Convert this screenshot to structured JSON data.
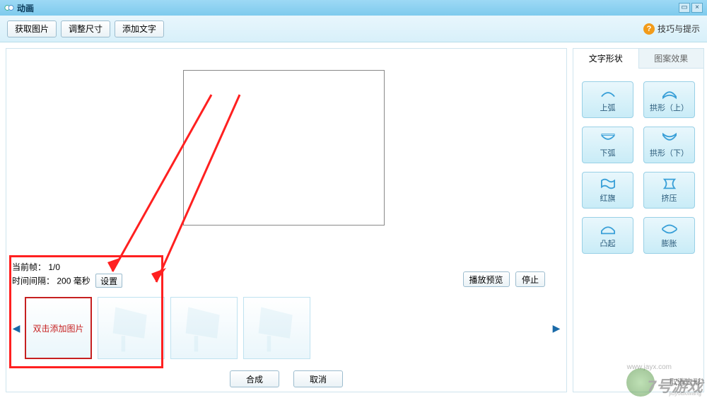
{
  "window": {
    "title": "动画"
  },
  "toolbar": {
    "get_image": "获取图片",
    "resize": "调整尺寸",
    "add_text": "添加文字",
    "tips": "技巧与提示"
  },
  "frame_info": {
    "current_frame_label": "当前帧：",
    "current_frame_value": "1/0",
    "interval_label": "时间间隔：",
    "interval_value": "200",
    "interval_unit": "毫秒",
    "set_btn": "设置"
  },
  "play": {
    "preview": "播放预览",
    "stop": "停止"
  },
  "frames": {
    "add_placeholder": "双击添加图片"
  },
  "bottom": {
    "compose": "合成",
    "cancel": "取消"
  },
  "side": {
    "tab_text_shape": "文字形状",
    "tab_pattern": "图案效果",
    "shapes": [
      {
        "label": "上弧"
      },
      {
        "label": "拱形（上）"
      },
      {
        "label": "下弧"
      },
      {
        "label": "拱形（下）"
      },
      {
        "label": "红旗"
      },
      {
        "label": "挤压"
      },
      {
        "label": "凸起"
      },
      {
        "label": "膨胀"
      }
    ],
    "cancel_warp": "取消变形"
  },
  "watermark": {
    "brand": "7号游戏",
    "url": "jiuyouxiwang"
  },
  "wm_url_top": "www.jayx.com"
}
